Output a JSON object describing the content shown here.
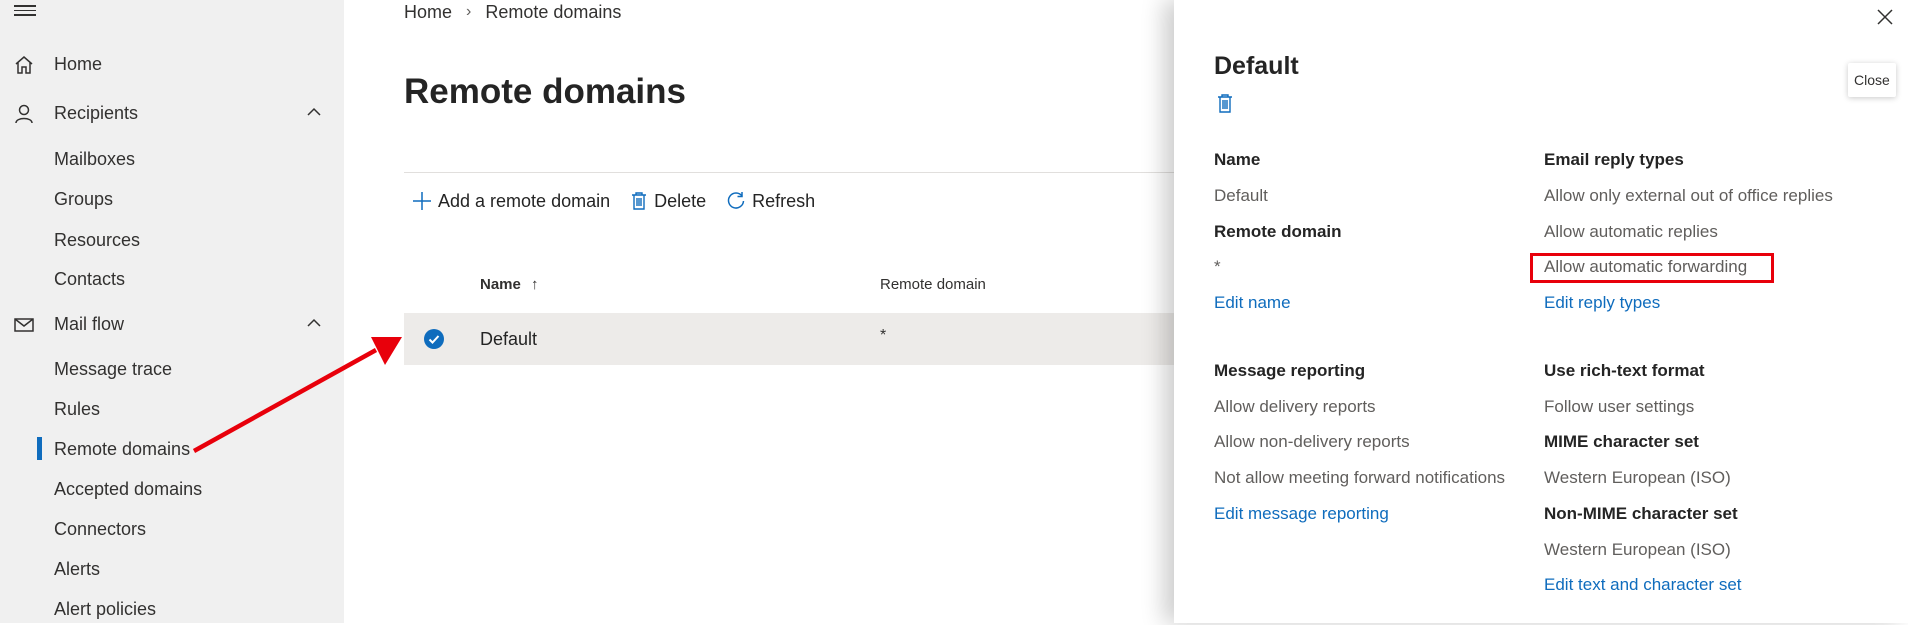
{
  "sidebar": {
    "items": [
      {
        "label": "Home"
      },
      {
        "label": "Recipients"
      },
      {
        "label": "Mail flow"
      }
    ],
    "recipients_sub": [
      "Mailboxes",
      "Groups",
      "Resources",
      "Contacts"
    ],
    "mailflow_sub": [
      "Message trace",
      "Rules",
      "Remote domains",
      "Accepted domains",
      "Connectors",
      "Alerts",
      "Alert policies"
    ]
  },
  "breadcrumb": {
    "home": "Home",
    "current": "Remote domains"
  },
  "page": {
    "title": "Remote domains"
  },
  "toolbar": {
    "add": "Add a remote domain",
    "delete": "Delete",
    "refresh": "Refresh"
  },
  "table": {
    "headers": {
      "name": "Name",
      "remote_domain": "Remote domain"
    },
    "rows": [
      {
        "name": "Default",
        "remote_domain": "*"
      }
    ]
  },
  "panel": {
    "title": "Default",
    "name_label": "Name",
    "name_value": "Default",
    "remote_domain_label": "Remote domain",
    "remote_domain_value": "*",
    "edit_name": "Edit name",
    "email_reply_label": "Email reply types",
    "email_reply_values": [
      "Allow only external out of office replies",
      "Allow automatic replies",
      "Allow automatic forwarding"
    ],
    "edit_reply": "Edit reply types",
    "message_reporting_label": "Message reporting",
    "message_reporting_values": [
      "Allow delivery reports",
      "Allow non-delivery reports",
      "Not allow meeting forward notifications"
    ],
    "edit_message_reporting": "Edit message reporting",
    "rich_text_label": "Use rich-text format",
    "rich_text_value": "Follow user settings",
    "mime_label": "MIME character set",
    "mime_value": "Western European (ISO)",
    "non_mime_label": "Non-MIME character set",
    "non_mime_value": "Western European (ISO)",
    "edit_text": "Edit text and character set",
    "close_tooltip": "Close"
  },
  "colors": {
    "accent": "#0f6cbd",
    "annotation": "#e8000b",
    "sidebar_bg": "#f0f0f0"
  }
}
